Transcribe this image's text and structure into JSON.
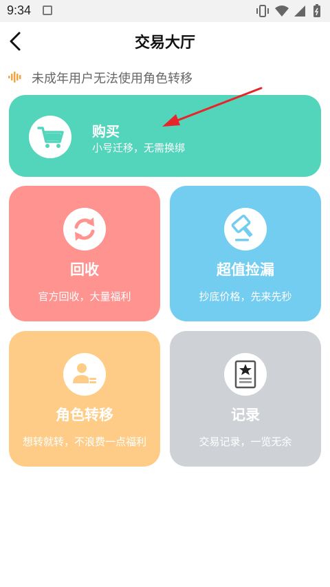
{
  "status_bar": {
    "time": "9:34",
    "icons": [
      "a-notification-icon",
      "vibrate-icon",
      "wifi-icon",
      "signal-icon",
      "battery-icon"
    ]
  },
  "header": {
    "title": "交易大厅",
    "back_icon": "back-arrow-icon"
  },
  "notice": {
    "icon": "sound-wave-icon",
    "text": "未成年用户无法使用角色转移"
  },
  "cards": {
    "buy": {
      "title": "购买",
      "subtitle": "小号迁移，无需换绑",
      "icon": "cart-icon",
      "color": "#52d5bb"
    },
    "recycle": {
      "title": "回收",
      "subtitle": "官方回收，大量福利",
      "icon": "refresh-icon",
      "color": "#fe9390"
    },
    "bargain": {
      "title": "超值捡漏",
      "subtitle": "抄底价格，先来先秒",
      "icon": "hammer-icon",
      "color": "#72cdf0"
    },
    "transfer": {
      "title": "角色转移",
      "subtitle": "想转就转，不浪费一点福利",
      "icon": "user-transfer-icon",
      "color": "#fecc86"
    },
    "record": {
      "title": "记录",
      "subtitle": "交易记录，一览无余",
      "icon": "record-document-icon",
      "color": "#ced2d6"
    }
  },
  "annotation": {
    "icon": "red-pointer-arrow"
  }
}
